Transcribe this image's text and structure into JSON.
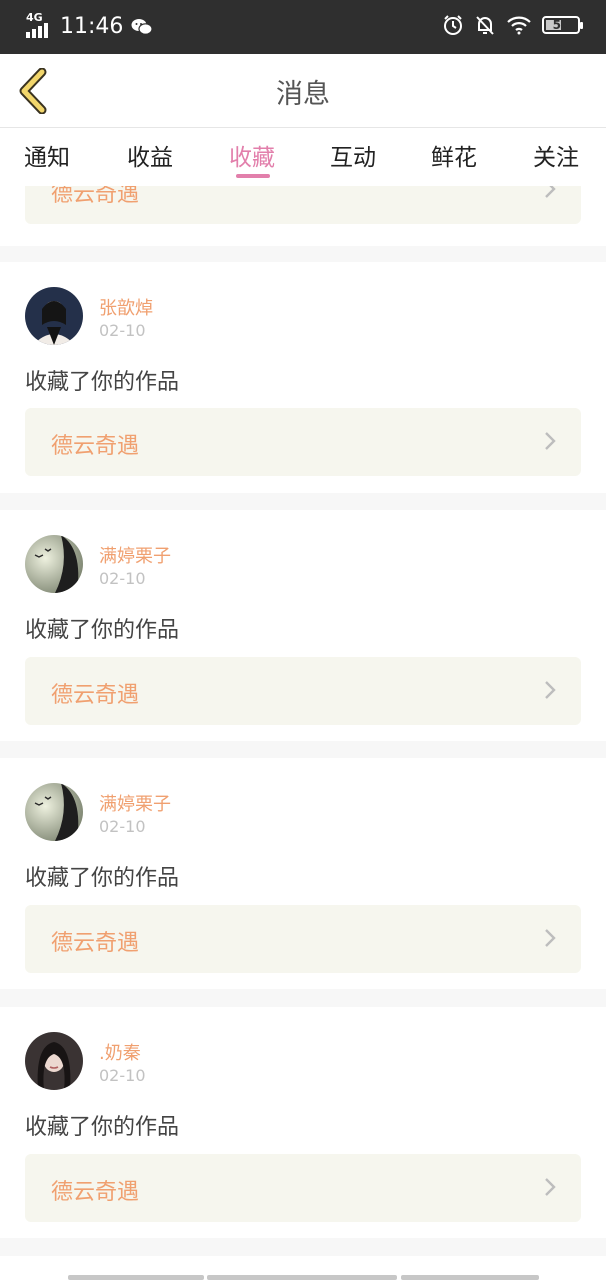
{
  "status_bar": {
    "network": "4G",
    "time": "11:46",
    "battery": "50",
    "battery_level": 0.5,
    "icons": [
      "signal-icon",
      "wechat-icon",
      "alarm-icon",
      "bell-off-icon",
      "wifi-icon",
      "battery-icon"
    ]
  },
  "header": {
    "title": "消息",
    "back_icon": "chevron-left-icon"
  },
  "tabs": [
    {
      "label": "通知",
      "active": false
    },
    {
      "label": "收益",
      "active": false
    },
    {
      "label": "收藏",
      "active": true
    },
    {
      "label": "互动",
      "active": false
    },
    {
      "label": "鲜花",
      "active": false
    },
    {
      "label": "关注",
      "active": false
    }
  ],
  "colors": {
    "accent_pink": "#e27fab",
    "accent_orange": "#f0a070",
    "work_bg": "#f6f6ee"
  },
  "top_partial_card": {
    "work_title": "德云奇遇"
  },
  "messages": [
    {
      "username": "张歆焯",
      "date": "02-10",
      "action": "收藏了你的作品",
      "work_title": "德云奇遇"
    },
    {
      "username": "满婷栗子",
      "date": "02-10",
      "action": "收藏了你的作品",
      "work_title": "德云奇遇"
    },
    {
      "username": "满婷栗子",
      "date": "02-10",
      "action": "收藏了你的作品",
      "work_title": "德云奇遇"
    },
    {
      "username": ".奶秦",
      "date": "02-10",
      "action": "收藏了你的作品",
      "work_title": "德云奇遇"
    }
  ]
}
